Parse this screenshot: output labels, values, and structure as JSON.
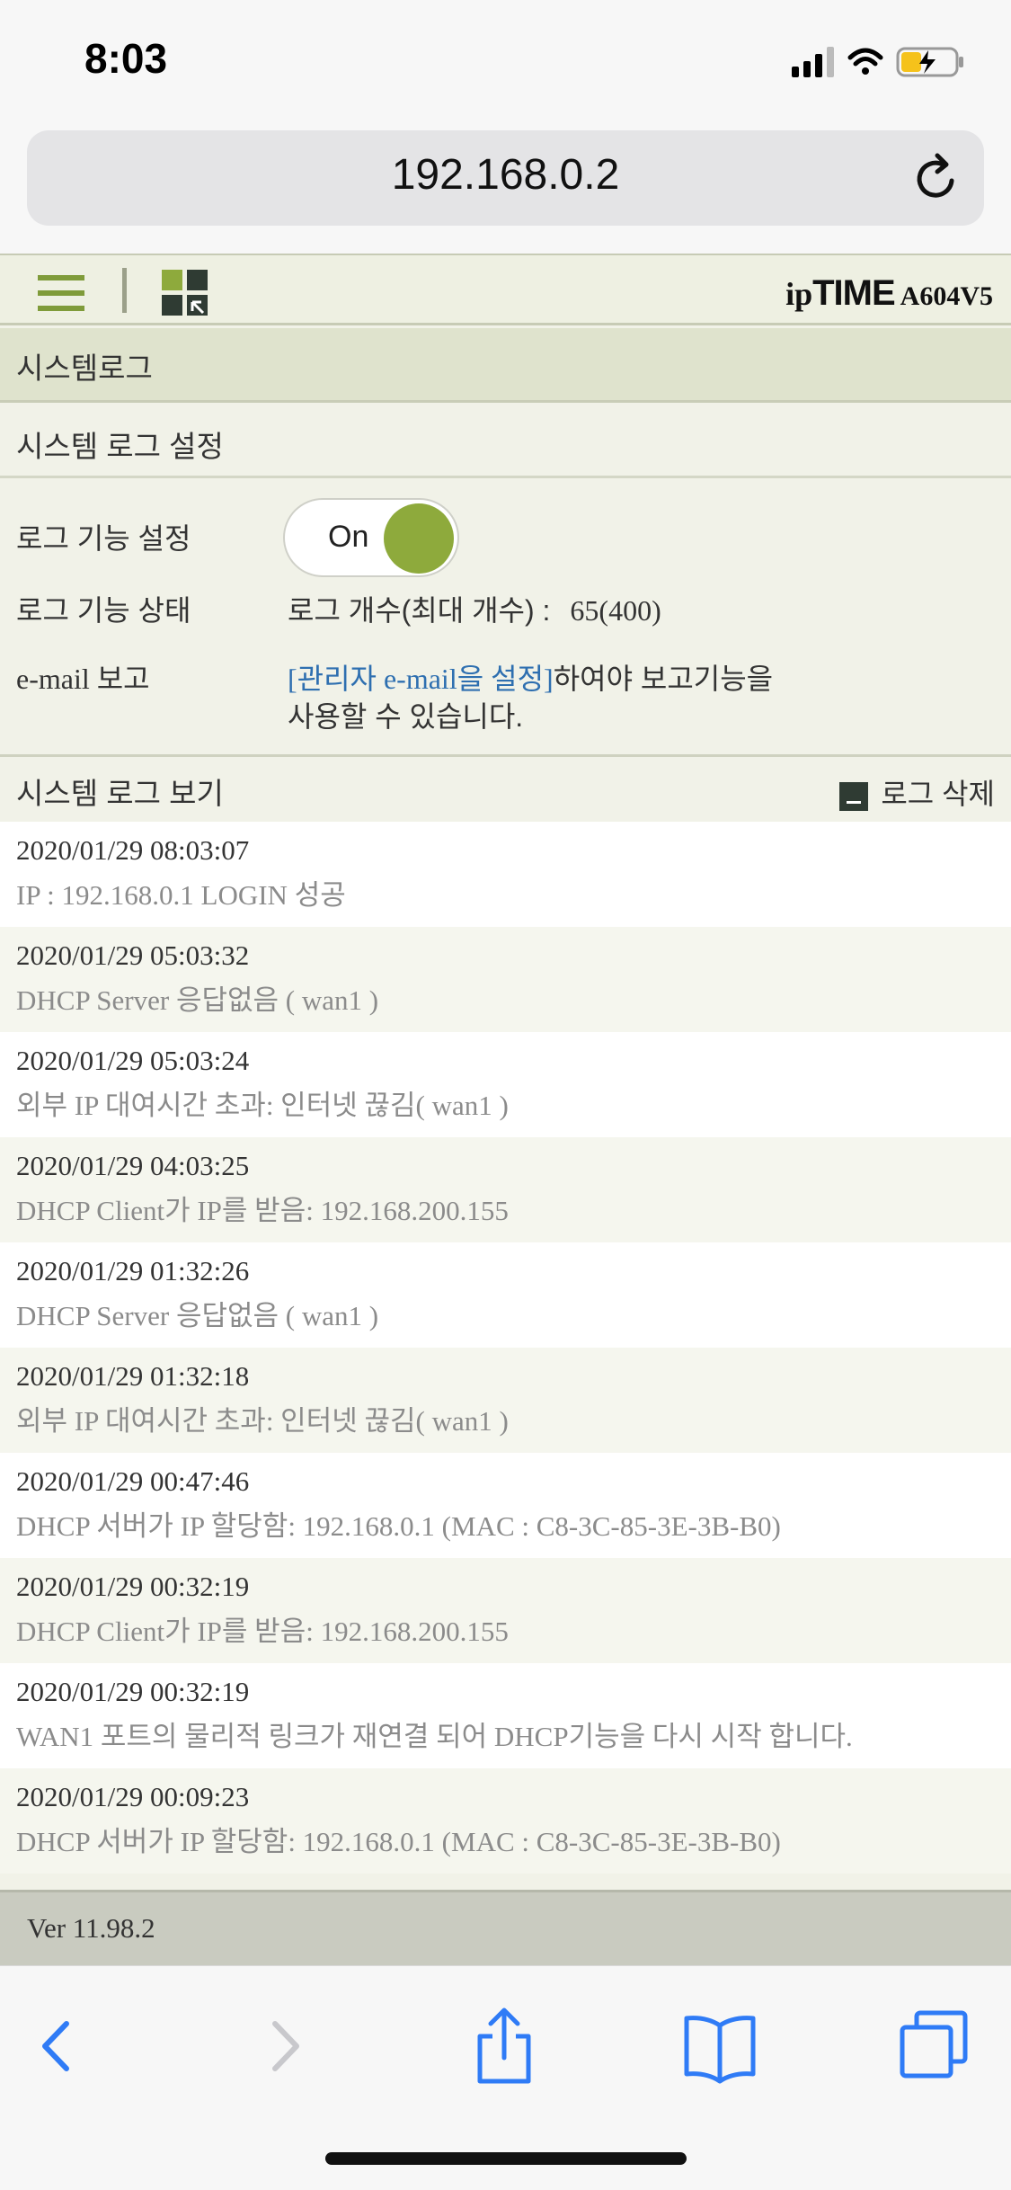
{
  "status_bar": {
    "time": "8:03"
  },
  "browser": {
    "url": "192.168.0.2"
  },
  "router": {
    "brand_ip": "ip",
    "brand_time": "TIME",
    "model": "A604V5",
    "section_title": "시스템로그",
    "settings_title": "시스템 로그 설정",
    "log_function_label": "로그 기능 설정",
    "log_function_toggle": "On",
    "log_status_label": "로그 기능 상태",
    "log_status_value_label": "로그 개수(최대 개수) :",
    "log_status_value": "65(400)",
    "email_label": "e-mail 보고",
    "email_link": "[관리자 e-mail을 설정]",
    "email_text_1": "하여야 보고기능을",
    "email_text_2": "사용할 수 있습니다.",
    "log_view_title": "시스템 로그 보기",
    "delete_label": "로그 삭제",
    "version": "Ver 11.98.2"
  },
  "logs": [
    {
      "time": "2020/01/29 08:03:07",
      "msg": "IP : 192.168.0.1 LOGIN 성공"
    },
    {
      "time": "2020/01/29 05:03:32",
      "msg": "DHCP Server 응답없음 ( wan1 )"
    },
    {
      "time": "2020/01/29 05:03:24",
      "msg": "외부 IP 대여시간 초과: 인터넷 끊김( wan1 )"
    },
    {
      "time": "2020/01/29 04:03:25",
      "msg": "DHCP Client가 IP를 받음: 192.168.200.155"
    },
    {
      "time": "2020/01/29 01:32:26",
      "msg": "DHCP Server 응답없음 ( wan1 )"
    },
    {
      "time": "2020/01/29 01:32:18",
      "msg": "외부 IP 대여시간 초과: 인터넷 끊김( wan1 )"
    },
    {
      "time": "2020/01/29 00:47:46",
      "msg": "DHCP 서버가 IP 할당함: 192.168.0.1 (MAC : C8-3C-85-3E-3B-B0)"
    },
    {
      "time": "2020/01/29 00:32:19",
      "msg": "DHCP Client가 IP를 받음: 192.168.200.155"
    },
    {
      "time": "2020/01/29 00:32:19",
      "msg": "WAN1 포트의 물리적 링크가 재연결 되어 DHCP기능을 다시 시작 합니다."
    },
    {
      "time": "2020/01/29 00:09:23",
      "msg": "DHCP 서버가 IP 할당함: 192.168.0.1 (MAC : C8-3C-85-3E-3B-B0)"
    }
  ],
  "colors": {
    "accent_green": "#8eaa3c",
    "link_blue": "#2e6fb0",
    "ios_blue": "#2f7bf6"
  },
  "icons": {
    "menu": "menu-icon",
    "tile": "tile-grid-icon",
    "reload": "reload-icon",
    "back": "back-chevron-icon",
    "forward": "forward-chevron-icon",
    "share": "share-icon",
    "bookmarks": "bookmarks-icon",
    "tabs": "tabs-icon"
  }
}
